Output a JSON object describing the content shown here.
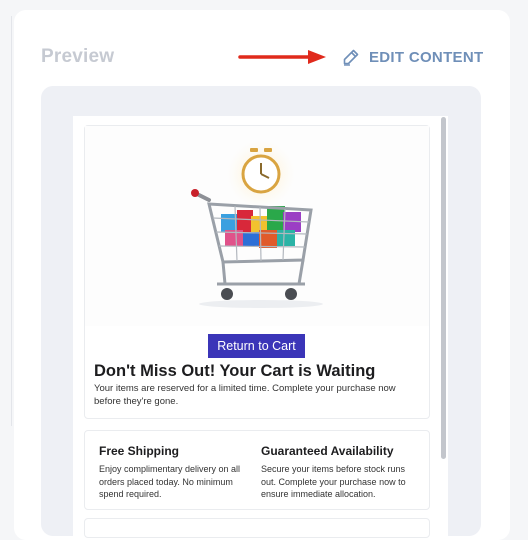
{
  "header": {
    "title": "Preview",
    "edit_label": "EDIT CONTENT"
  },
  "email": {
    "cta_label": "Return to Cart",
    "headline": "Don't Miss Out! Your Cart is Waiting",
    "body": "Your items are reserved for a limited time. Complete your purchase now before they're gone.",
    "features": [
      {
        "title": "Free Shipping",
        "text": "Enjoy complimentary delivery on all orders placed today. No minimum spend required."
      },
      {
        "title": "Guaranteed Availability",
        "text": "Secure your items before stock runs out. Complete your purchase now to ensure immediate allocation."
      }
    ]
  },
  "colors": {
    "accent": "#3b35b8",
    "edit_link": "#6f8fb8",
    "arrow": "#e02a1c"
  }
}
